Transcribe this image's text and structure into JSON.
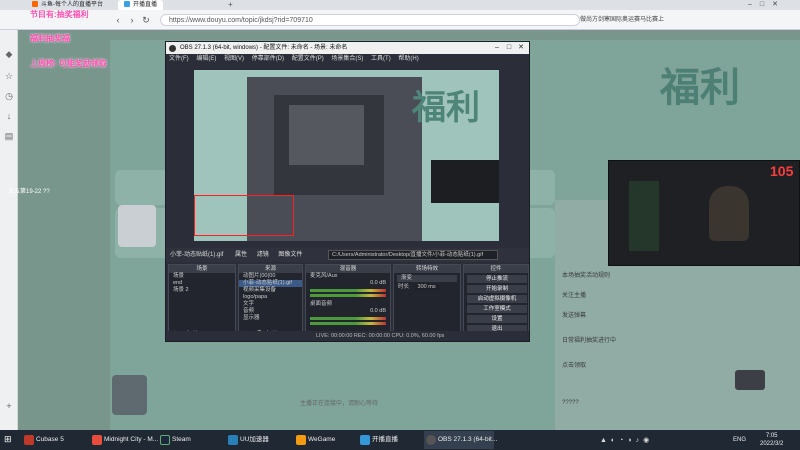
{
  "browser": {
    "tabs": [
      {
        "label": "斗鱼-每个人的直播平台"
      },
      {
        "label": "开播直播",
        "active": true
      }
    ],
    "url": "https://www.douyu.com/topic/jkdsj?rid=709710",
    "adtext": "做尚方剑寒国际奥运赛马比赛上"
  },
  "stream": {
    "danmu": [
      "节目有:抽奖福利",
      "福利抽奖福",
      "上周榜: 可能奖励领取"
    ],
    "danmu_user": "五五第19-22 ??",
    "big_title": "福利",
    "viewer_badge": "105",
    "footer_text": "主播正在连接中，请耐心等待",
    "chat": [
      "本场抽奖活动规则",
      "关注主播",
      "发送弹幕",
      "日常福利抽奖进行中",
      "点击领取",
      "?????"
    ]
  },
  "obs": {
    "title": "OBS 27.1.3 (64-bit, windows) - 配置文件: 未命名 - 场景: 未命名",
    "menu": [
      "文件(F)",
      "编辑(E)",
      "视图(V)",
      "停靠部件(D)",
      "配置文件(P)",
      "场景集合(S)",
      "工具(T)",
      "帮助(H)"
    ],
    "source_bar": {
      "source_name": "小菲-动态贴纸(1).gif",
      "properties": "属性",
      "filters": "滤镜",
      "image_file": "图像文件",
      "path": "C:/Users/Administrator/Desktop/直播文件/小菲-动态贴纸(1).gif"
    },
    "scenes": {
      "header": "场景",
      "items": [
        "场景",
        "end",
        "场景 2"
      ]
    },
    "sources": {
      "header": "来源",
      "items": [
        "动图片(00(00",
        "小菲-动态贴纸(1).gif",
        "视频采集设备",
        "logo/papa",
        "文字",
        "音频",
        "显示器"
      ]
    },
    "mixer": {
      "header": "混音器",
      "tracks": [
        {
          "name": "麦克风/Aux",
          "db": "0.0 dB"
        },
        {
          "name": "桌面音频",
          "db": "0.0 dB"
        }
      ]
    },
    "transitions": {
      "header": "转场特效",
      "type": "渐变",
      "duration_label": "时长",
      "duration": "300 ms"
    },
    "controls": {
      "header": "控件",
      "buttons": [
        "停止推流",
        "开始录制",
        "启动虚拟摄像机",
        "工作室模式",
        "设置",
        "退出"
      ]
    },
    "status": "LIVE: 00:00:00   REC: 00:00:00   CPU: 0.0%, 60.00 fps"
  },
  "taskbar": {
    "items": [
      {
        "label": "Cubase 5",
        "color": "#c0392b"
      },
      {
        "label": "Midnight City - M...",
        "color": "#e74c3c"
      },
      {
        "label": "Steam",
        "color": "#1b2838"
      },
      {
        "label": "UU加速器",
        "color": "#2980b9"
      },
      {
        "label": "WeGame",
        "color": "#f39c12"
      },
      {
        "label": "开播直播",
        "color": "#3498db"
      },
      {
        "label": "OBS 27.1.3 (64-bit...",
        "color": "#555"
      }
    ],
    "lang": "ENG",
    "time": "7:05",
    "date": "2022/3/2"
  }
}
